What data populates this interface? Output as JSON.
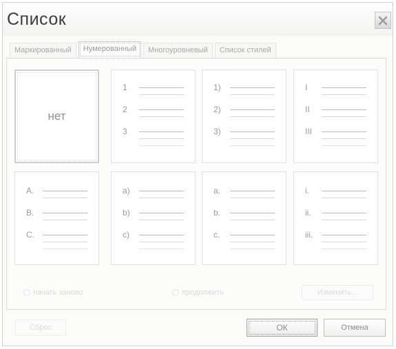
{
  "dialog": {
    "title": "Список",
    "close_icon": "close-icon"
  },
  "tabs": [
    {
      "label": "Маркированный",
      "active": false
    },
    {
      "label": "Нумерованный",
      "active": true
    },
    {
      "label": "Многоуровневый",
      "active": false
    },
    {
      "label": "Список стилей",
      "active": false
    }
  ],
  "styles": {
    "none_label": "нет",
    "top": [
      {
        "markers": [
          "1",
          "2",
          "3"
        ]
      },
      {
        "markers": [
          "1)",
          "2)",
          "3)"
        ]
      },
      {
        "markers": [
          "I",
          "II",
          "III"
        ]
      }
    ],
    "bottom": [
      {
        "markers": [
          "A.",
          "B.",
          "C."
        ]
      },
      {
        "markers": [
          "a)",
          "b)",
          "c)"
        ]
      },
      {
        "markers": [
          "a.",
          "b.",
          "c."
        ]
      },
      {
        "markers": [
          "i.",
          "ii.",
          "iii."
        ]
      }
    ]
  },
  "options": {
    "restart_label": "начать заново",
    "continue_label": "продолжить",
    "change_label": "Изменить..."
  },
  "footer": {
    "reset_label": "Сброс",
    "ok_label": "ОК",
    "cancel_label": "Отмена"
  }
}
